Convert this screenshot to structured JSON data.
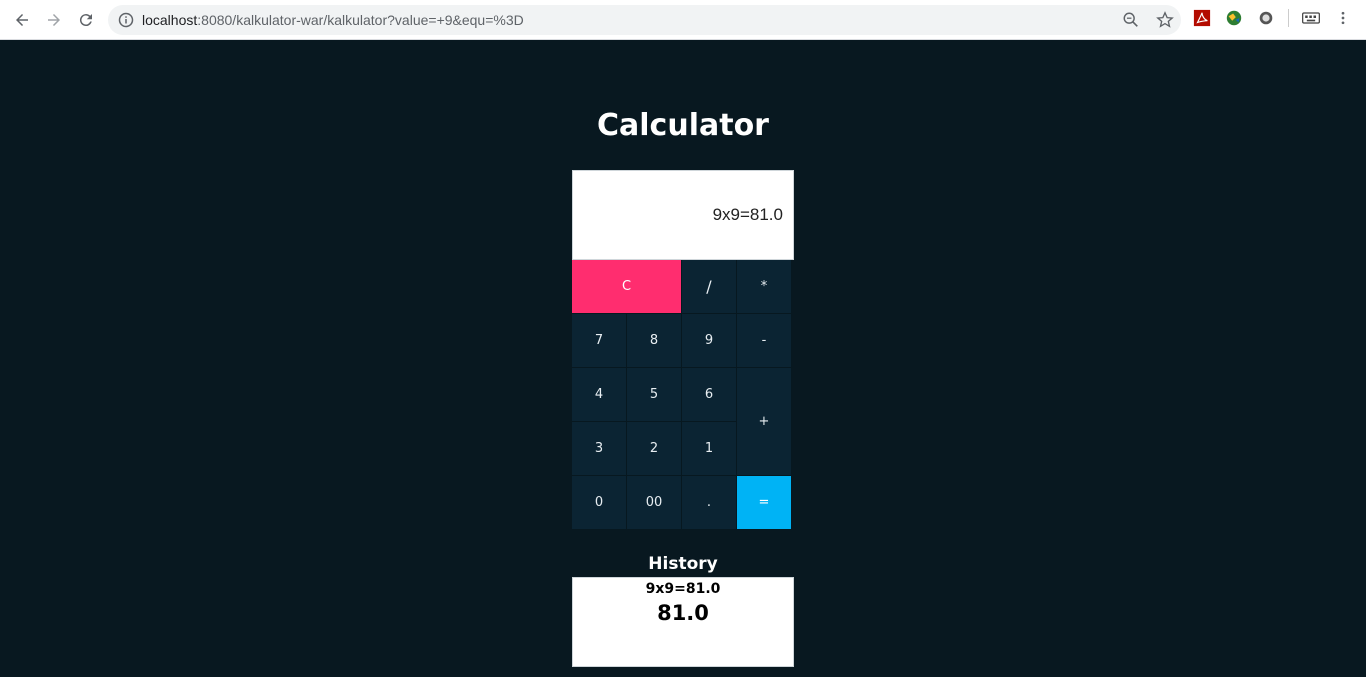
{
  "browser": {
    "url_host": "localhost",
    "url_rest": ":8080/kalkulator-war/kalkulator?value=+9&equ=%3D",
    "icons": [
      "back-icon",
      "forward-icon",
      "reload-icon",
      "info-icon",
      "zoom-icon",
      "star-icon",
      "pdf-extension-icon",
      "globe-extension-icon",
      "circle-extension-icon",
      "keyboard-extension-icon",
      "menu-icon"
    ]
  },
  "page": {
    "title": "Calculator",
    "display_value": "9x9=81.0"
  },
  "keys": {
    "clear": "C",
    "divide": "/",
    "multiply": "*",
    "seven": "7",
    "eight": "8",
    "nine": "9",
    "minus": "-",
    "four": "4",
    "five": "5",
    "six": "6",
    "plus": "+",
    "three": "3",
    "two": "2",
    "one": "1",
    "zero": "0",
    "double_zero": "00",
    "dot": ".",
    "equals": "="
  },
  "history": {
    "title": "History",
    "expression": "9x9=81.0",
    "result": "81.0"
  },
  "colors": {
    "background": "#081820",
    "key": "#0b2433",
    "clear": "#ff2d6f",
    "equals": "#00b3f5"
  }
}
